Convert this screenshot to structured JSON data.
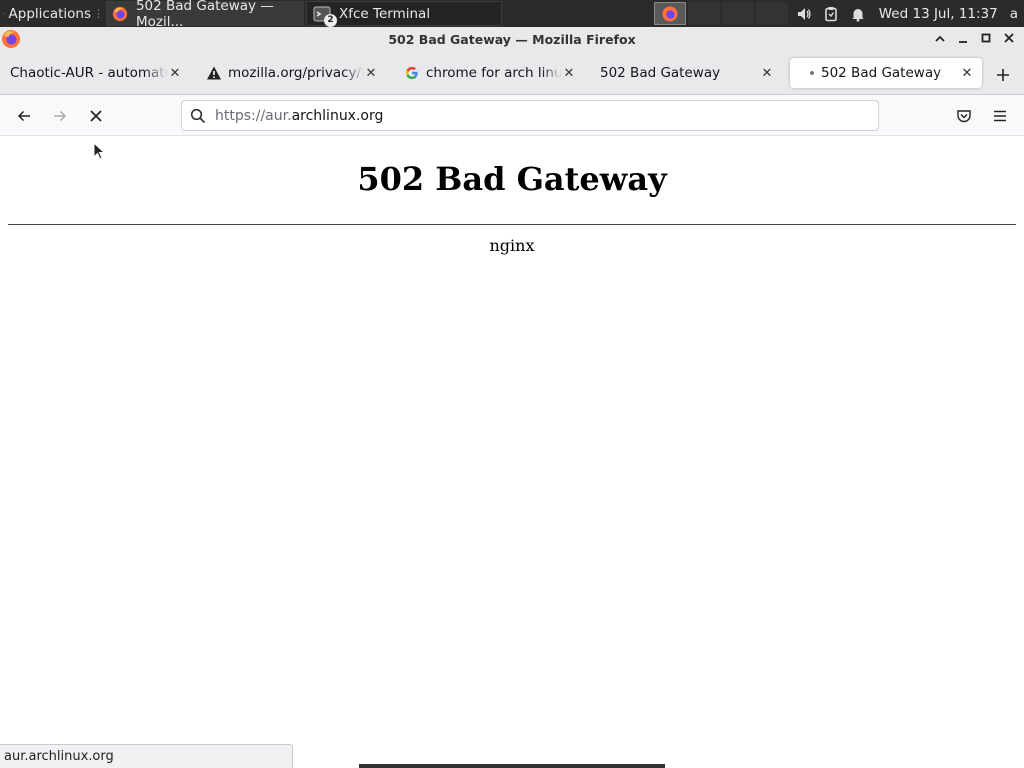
{
  "panel": {
    "apps_label": "Applications",
    "tasks": [
      {
        "label": "502 Bad Gateway — Mozil...",
        "icon": "firefox-icon"
      },
      {
        "label": "Xfce Terminal",
        "icon": "terminal-icon",
        "badge": "2"
      }
    ],
    "clock": "Wed 13 Jul, 11:37",
    "user": "a",
    "tray_icons": [
      "volume-icon",
      "clipboard-icon",
      "notification-bell-icon"
    ]
  },
  "window": {
    "title": "502 Bad Gateway — Mozilla Firefox"
  },
  "tabs": [
    {
      "label": "Chaotic-AUR - automated",
      "favicon": "none"
    },
    {
      "label": "mozilla.org/privacy/firefox",
      "favicon": "warning-icon"
    },
    {
      "label": "chrome for arch linux",
      "favicon": "google-icon"
    },
    {
      "label": "502 Bad Gateway",
      "favicon": "none"
    },
    {
      "label": "502 Bad Gateway",
      "favicon": "loading-dot",
      "selected": true
    }
  ],
  "navbar": {
    "url_prefix": "https://aur.",
    "url_domain": "archlinux.org"
  },
  "page": {
    "heading": "502 Bad Gateway",
    "server": "nginx"
  },
  "status": {
    "text": "aur.archlinux.org"
  },
  "colors": {
    "panel_bg": "#2b2b2b",
    "chrome_bg": "#e9e9ec",
    "navbar_bg": "#f9f9fb"
  }
}
